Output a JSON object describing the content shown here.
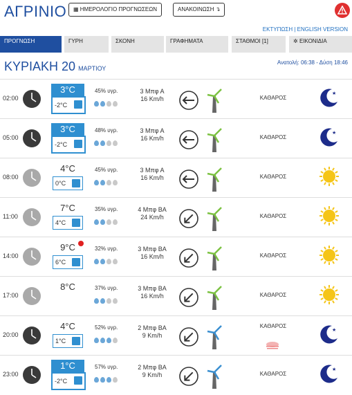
{
  "header": {
    "city": "ΑΓΡΙΝΙΟ",
    "calendar_button": "ΗΜΕΡΟΛΟΓΙΟ ΠΡΟΓΝΩΣΕΩΝ",
    "announcement_button": "ΑΝΑΚΟΙΝΩΣΗ",
    "links": "ΕΚΤΥΠΩΣΗ | ENGLISH VERSION",
    "alert_color": "#e03030"
  },
  "tabs": [
    {
      "label": "ΠΡΟΓΝΩΣΗ"
    },
    {
      "label": "ΓΥΡΗ"
    },
    {
      "label": "ΣΚΟΝΗ"
    },
    {
      "label": "ΓΡΑΦΗΜΑΤΑ"
    },
    {
      "label": "ΣΤΑΘΜΟΙ [1]"
    },
    {
      "label": "ΕΙΚΟΝΙΔΙΑ"
    }
  ],
  "day": {
    "title": "ΚΥΡΙΑΚΗ 20",
    "month": "ΜΑΡΤΙΟΥ",
    "sun": "Ανατολή: 06:38 - Δύση 18:46"
  },
  "rows": [
    {
      "time": "02:00",
      "tmax": "3°C",
      "tmin": "-2°C",
      "hum": "45% υγρ.",
      "drops": 2,
      "wind": "3 Μπφ Α",
      "speed": "16 Km/h",
      "dir": "E",
      "desc": "ΚΑΘΑΡΟΣ",
      "icon": "moon-icon",
      "clock": "night",
      "cold": true,
      "alert": false
    },
    {
      "time": "05:00",
      "tmax": "3°C",
      "tmin": "-2°C",
      "hum": "48% υγρ.",
      "drops": 2,
      "wind": "3 Μπφ Α",
      "speed": "16 Km/h",
      "dir": "E",
      "desc": "ΚΑΘΑΡΟΣ",
      "icon": "moon-icon",
      "clock": "night",
      "cold": true,
      "alert": false
    },
    {
      "time": "08:00",
      "tmax": "4°C",
      "tmin": "0°C",
      "hum": "45% υγρ.",
      "drops": 2,
      "wind": "3 Μπφ Α",
      "speed": "16 Km/h",
      "dir": "E",
      "desc": "ΚΑΘΑΡΟΣ",
      "icon": "sun-icon",
      "clock": "day",
      "cold": false,
      "alert": false
    },
    {
      "time": "11:00",
      "tmax": "7°C",
      "tmin": "4°C",
      "hum": "35% υγρ.",
      "drops": 2,
      "wind": "4 Μπφ ΒΑ",
      "speed": "24 Km/h",
      "dir": "NE",
      "desc": "ΚΑΘΑΡΟΣ",
      "icon": "sun-icon",
      "clock": "day",
      "cold": false,
      "alert": false
    },
    {
      "time": "14:00",
      "tmax": "9°C",
      "tmin": "6°C",
      "hum": "32% υγρ.",
      "drops": 2,
      "wind": "3 Μπφ ΒΑ",
      "speed": "16 Km/h",
      "dir": "NE",
      "desc": "ΚΑΘΑΡΟΣ",
      "icon": "sun-icon",
      "clock": "day",
      "cold": false,
      "alert": true
    },
    {
      "time": "17:00",
      "tmax": "8°C",
      "tmin": "",
      "hum": "37% υγρ.",
      "drops": 2,
      "wind": "3 Μπφ ΒΑ",
      "speed": "16 Km/h",
      "dir": "NE",
      "desc": "ΚΑΘΑΡΟΣ",
      "icon": "sun-icon",
      "clock": "day",
      "cold": false,
      "alert": false
    },
    {
      "time": "20:00",
      "tmax": "4°C",
      "tmin": "1°C",
      "hum": "52% υγρ.",
      "drops": 3,
      "wind": "2 Μπφ ΒΑ",
      "speed": "9 Km/h",
      "dir": "NE",
      "desc": "ΚΑΘΑΡΟΣ",
      "icon": "moon-icon",
      "clock": "night",
      "cold": false,
      "alert": false,
      "fog": true
    },
    {
      "time": "23:00",
      "tmax": "1°C",
      "tmin": "-2°C",
      "hum": "57% υγρ.",
      "drops": 3,
      "wind": "2 Μπφ ΒΑ",
      "speed": "9 Km/h",
      "dir": "NE",
      "desc": "ΚΑΘΑΡΟΣ",
      "icon": "moon-icon",
      "clock": "night",
      "cold": true,
      "alert": false
    }
  ],
  "colors": {
    "accent": "#1f4fa0",
    "cold": "#2f8fd0",
    "sun": "#f5c518",
    "moon": "#1d2c8a",
    "turbine_green": "#7cc242",
    "turbine_blue": "#3a8fd0"
  }
}
